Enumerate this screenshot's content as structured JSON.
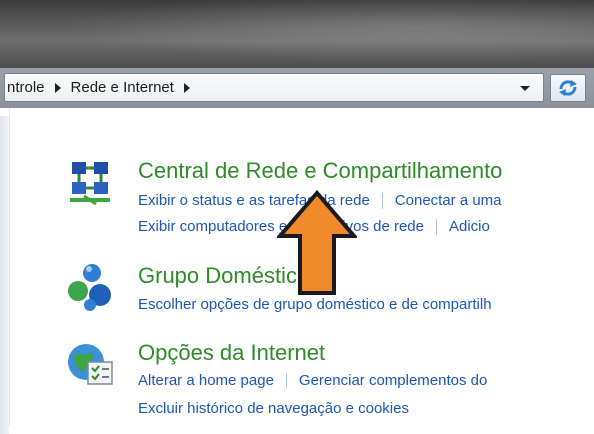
{
  "window": {
    "title": ""
  },
  "address": {
    "crumbs": [
      "ntrole",
      "Rede e Internet"
    ],
    "dropdown_icon": "chevron-down-icon",
    "refresh_icon": "refresh-icon"
  },
  "sections": [
    {
      "id": "network-center",
      "icon": "network-center-icon",
      "title": "Central de Rede e Compartilhamento",
      "rows": [
        [
          "Exibir o status e as tarefas da rede",
          "Conectar a uma"
        ],
        [
          "Exibir computadores e dispositivos de rede",
          "Adicio"
        ]
      ]
    },
    {
      "id": "homegroup",
      "icon": "homegroup-icon",
      "title": "Grupo Doméstico",
      "rows": [
        [
          "Escolher opções de grupo doméstico e de compartilh"
        ]
      ]
    },
    {
      "id": "internet-options",
      "icon": "internet-options-icon",
      "title": "Opções da Internet",
      "rows": [
        [
          "Alterar a home page",
          "Gerenciar complementos do"
        ],
        [
          "Excluir histórico de navegação e cookies"
        ]
      ]
    }
  ],
  "annotation": {
    "icon": "arrow-up-icon",
    "color": "#f08a2a"
  }
}
